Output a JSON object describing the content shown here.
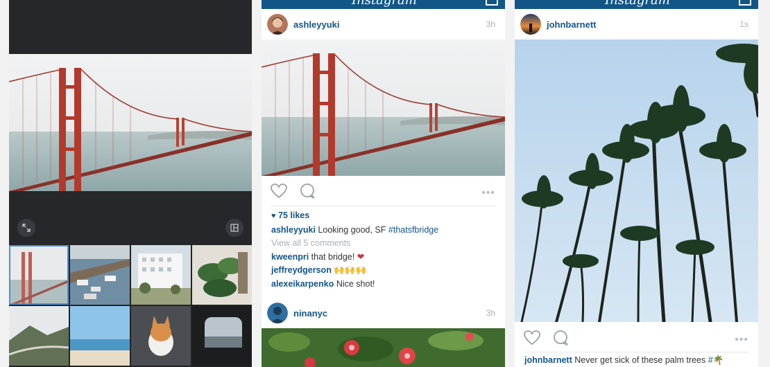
{
  "colors": {
    "brand": "#125688",
    "picker_bg": "#222326",
    "muted": "#aab0b6",
    "selection": "#4a90d9"
  },
  "picker": {
    "preview_alt": "Golden Gate Bridge preview",
    "expand_icon": "expand-icon",
    "layout_icon": "layout-icon",
    "thumbnails": [
      {
        "name": "golden-gate",
        "selected": true
      },
      {
        "name": "harbor-boats",
        "selected": false
      },
      {
        "name": "white-building",
        "selected": false
      },
      {
        "name": "houseplant",
        "selected": false
      },
      {
        "name": "mountain-road",
        "selected": false
      },
      {
        "name": "beach",
        "selected": false
      },
      {
        "name": "corgi",
        "selected": false
      },
      {
        "name": "window-view",
        "selected": false
      }
    ]
  },
  "feed1": {
    "post1": {
      "username": "ashleyyuki",
      "time": "3h",
      "likes": "75 likes",
      "caption_user": "ashleyyuki",
      "caption_text": "Looking good, SF",
      "caption_tag": "#thatsfbridge",
      "view_all": "View all 5 comments",
      "comments": [
        {
          "user": "kweenpri",
          "text": "that bridge!",
          "emoji": "❤"
        },
        {
          "user": "jeffreydgerson",
          "text": "",
          "emoji": "🙌🙌🙌"
        },
        {
          "user": "alexeikarpenko",
          "text": "Nice shot!",
          "emoji": ""
        }
      ]
    },
    "post2": {
      "username": "ninanyc",
      "time": "3h"
    }
  },
  "feed2": {
    "post1": {
      "username": "johnbarnett",
      "time": "1s",
      "caption_user": "johnbarnett",
      "caption_text": "Never get sick of these palm trees",
      "caption_tag": "#",
      "caption_emoji": "🌴"
    }
  },
  "more_glyph": "•••"
}
